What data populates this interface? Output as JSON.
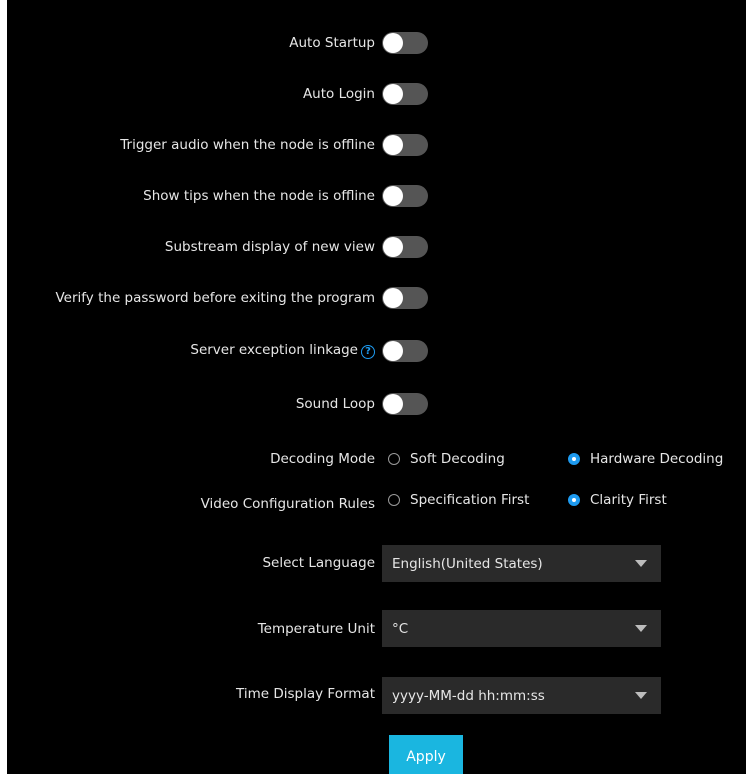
{
  "settings": {
    "toggles": [
      {
        "label": "Auto Startup",
        "on": false
      },
      {
        "label": "Auto Login",
        "on": false
      },
      {
        "label": "Trigger audio when the node is offline",
        "on": false
      },
      {
        "label": "Show tips when the node is offline",
        "on": false
      },
      {
        "label": "Substream display of new view",
        "on": false
      },
      {
        "label": "Verify the password before exiting the program",
        "on": false
      },
      {
        "label": "Server exception linkage",
        "on": false,
        "help_icon": "question-circle-icon"
      },
      {
        "label": "Sound Loop",
        "on": false
      }
    ],
    "decoding_mode": {
      "label": "Decoding Mode",
      "options": [
        "Soft Decoding",
        "Hardware Decoding"
      ],
      "selected": "Hardware Decoding"
    },
    "video_rules": {
      "label": "Video Configuration Rules",
      "options": [
        "Specification First",
        "Clarity First"
      ],
      "selected": "Clarity First"
    },
    "language": {
      "label": "Select Language",
      "value": "English(United States)"
    },
    "temperature": {
      "label": "Temperature Unit",
      "value": "°C"
    },
    "time_format": {
      "label": "Time Display Format",
      "value": "yyyy-MM-dd hh:mm:ss"
    },
    "apply_label": "Apply"
  },
  "colors": {
    "background": "#000000",
    "accent": "#1e9bf0",
    "button": "#1ab6e0",
    "toggle_off": "#555555",
    "select_bg": "#2a2a2a"
  }
}
